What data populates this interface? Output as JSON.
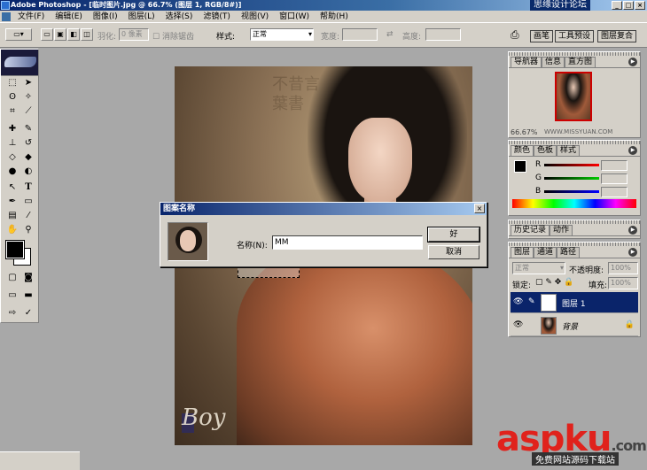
{
  "window": {
    "title": "Adobe Photoshop - [临时图片.jpg @ 66.7% (图层 1, RGB/8#)]",
    "watermark": "思缘设计论坛",
    "minimize": "_",
    "maximize": "□",
    "close": "×"
  },
  "menu": [
    "文件(F)",
    "编辑(E)",
    "图像(I)",
    "图层(L)",
    "选择(S)",
    "滤镜(T)",
    "视图(V)",
    "窗口(W)",
    "帮助(H)"
  ],
  "options": {
    "feather_label": "羽化:",
    "feather_value": "0 像素",
    "antialias_label": "消除锯齿",
    "style_label": "样式:",
    "style_value": "正常",
    "width_label": "宽度:",
    "height_label": "高度:",
    "swap": "⇄",
    "palette_tabs": [
      "画笔",
      "工具预设",
      "图层复合"
    ]
  },
  "navigator": {
    "tabs": [
      "导航器",
      "信息",
      "直方图"
    ],
    "zoom": "66.67%",
    "watermark": "WWW.MISSYUAN.COM"
  },
  "color": {
    "tabs": [
      "颜色",
      "色板",
      "样式"
    ],
    "channels": [
      "R",
      "G",
      "B"
    ],
    "colors": {
      "R": "#d00000",
      "G": "#00a000",
      "B": "#0000d0"
    }
  },
  "history": {
    "tabs": [
      "历史记录",
      "动作"
    ]
  },
  "layers": {
    "tabs": [
      "图层",
      "通道",
      "路径"
    ],
    "blend_mode": "正常",
    "opacity_label": "不透明度:",
    "opacity_value": "100%",
    "lock_label": "锁定:",
    "fill_label": "填充:",
    "fill_value": "100%",
    "rows": [
      {
        "name": "图层 1",
        "selected": true
      },
      {
        "name": "背景",
        "selected": false
      }
    ]
  },
  "dialog": {
    "title": "图案名称",
    "name_label": "名称(N):",
    "name_value": "MM",
    "ok": "好",
    "cancel": "取消",
    "close": "×"
  },
  "canvas": {
    "calligraphy": "不昔言葉書",
    "logo_text": "Boy"
  },
  "watermark": {
    "brand": "aspku",
    "domain": ".com",
    "subtitle": "免费网站源码下载站"
  }
}
